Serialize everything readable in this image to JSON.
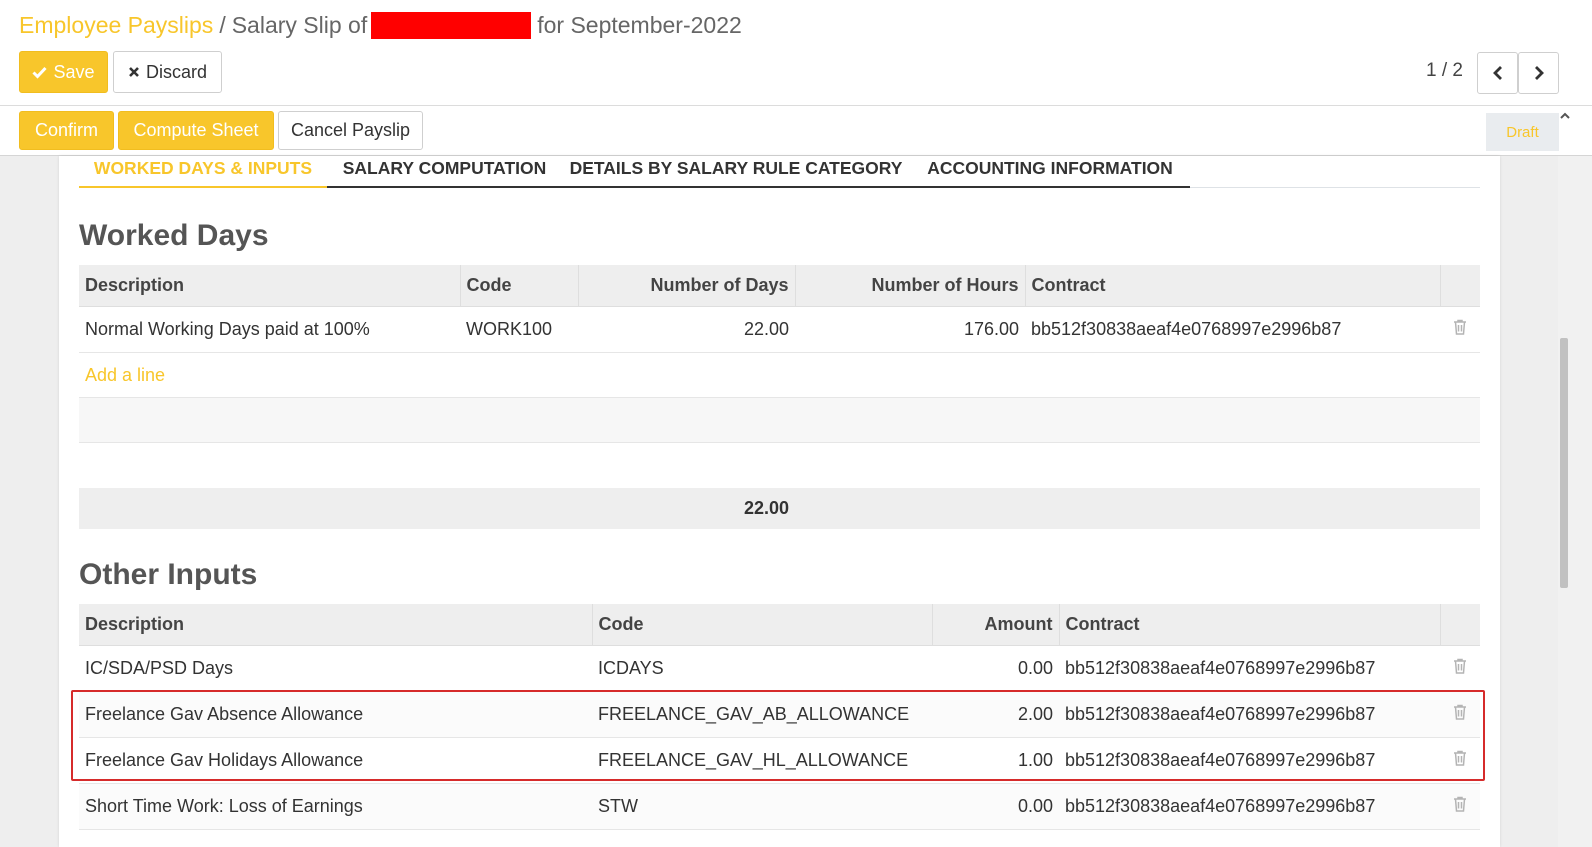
{
  "breadcrumb": {
    "parent": "Employee Payslips",
    "separator": "/",
    "current_prefix": "Salary Slip of",
    "current_suffix": "for September-2022"
  },
  "toolbar": {
    "save_label": "Save",
    "discard_label": "Discard"
  },
  "pager": {
    "value": "1 / 2"
  },
  "statusbar": {
    "confirm_label": "Confirm",
    "compute_label": "Compute Sheet",
    "cancel_label": "Cancel Payslip",
    "state": "Draft"
  },
  "tabs": [
    {
      "label": "WORKED DAYS & INPUTS",
      "active": true
    },
    {
      "label": "SALARY COMPUTATION",
      "active": false
    },
    {
      "label": "DETAILS BY SALARY RULE CATEGORY",
      "active": false
    },
    {
      "label": "ACCOUNTING INFORMATION",
      "active": false
    }
  ],
  "worked_days": {
    "title": "Worked Days",
    "columns": [
      "Description",
      "Code",
      "Number of Days",
      "Number of Hours",
      "Contract"
    ],
    "rows": [
      {
        "description": "Normal Working Days paid at 100%",
        "code": "WORK100",
        "days": "22.00",
        "hours": "176.00",
        "contract": "bb512f30838aeaf4e0768997e2996b87"
      }
    ],
    "add_line": "Add a line",
    "total_days": "22.00"
  },
  "other_inputs": {
    "title": "Other Inputs",
    "columns": [
      "Description",
      "Code",
      "Amount",
      "Contract"
    ],
    "rows": [
      {
        "description": "IC/SDA/PSD Days",
        "code": "ICDAYS",
        "amount": "0.00",
        "contract": "bb512f30838aeaf4e0768997e2996b87"
      },
      {
        "description": "Freelance Gav Absence Allowance",
        "code": "FREELANCE_GAV_AB_ALLOWANCE",
        "amount": "2.00",
        "contract": "bb512f30838aeaf4e0768997e2996b87"
      },
      {
        "description": "Freelance Gav Holidays Allowance",
        "code": "FREELANCE_GAV_HL_ALLOWANCE",
        "amount": "1.00",
        "contract": "bb512f30838aeaf4e0768997e2996b87"
      },
      {
        "description": "Short Time Work: Loss of Earnings",
        "code": "STW",
        "amount": "0.00",
        "contract": "bb512f30838aeaf4e0768997e2996b87"
      }
    ]
  },
  "colors": {
    "accent": "#f8c62b",
    "highlight_border": "#d62b2b",
    "redaction": "#ff0000"
  },
  "icons": {
    "save": "check-icon",
    "discard": "times-icon",
    "pager_prev": "chevron-left-icon",
    "pager_next": "chevron-right-icon",
    "row_delete": "trash-icon"
  }
}
